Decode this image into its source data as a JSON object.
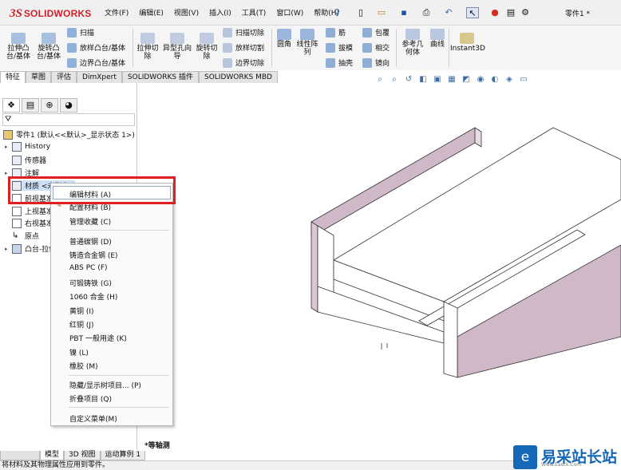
{
  "app": {
    "logo_ds": "3S",
    "logo_text": "SOLIDWORKS",
    "doc_title": "零件1 *"
  },
  "menu": [
    "文件(F)",
    "编辑(E)",
    "视图(V)",
    "插入(I)",
    "工具(T)",
    "窗口(W)",
    "帮助(H)"
  ],
  "commands": {
    "extrude_boss": "拉伸凸台/基体",
    "revolve_boss": "旋转凸台/基体",
    "sweep": "扫描",
    "loft_boss": "放样凸台/基体",
    "boundary_boss": "边界凸台/基体",
    "extrude_cut": "拉伸切除",
    "hole_wizard": "异型孔向导",
    "revolve_cut": "旋转切除",
    "sweep_cut": "扫描切除",
    "loft_cut": "放样切割",
    "boundary_cut": "边界切除",
    "fillet": "圆角",
    "linear_pattern": "线性阵列",
    "rib": "筋",
    "wrap": "包覆",
    "draft": "拔模",
    "intersect": "相交",
    "shell": "抽壳",
    "mirror": "镜向",
    "ref_geometry": "参考几何体",
    "curves": "曲线",
    "instant3d": "Instant3D"
  },
  "tabs": [
    "特征",
    "草图",
    "评估",
    "DimXpert",
    "SOLIDWORKS 插件",
    "SOLIDWORKS MBD"
  ],
  "tree": {
    "root": "零件1  (默认<<默认>_显示状态 1>)",
    "history": "History",
    "sensors": "传感器",
    "annotations": "注解",
    "material": "材质 <未指定>",
    "front_plane": "前视基准面",
    "top_plane": "上视基准面",
    "right_plane": "右视基准面",
    "origin": "原点",
    "boss_extrude": "凸台-拉伸1"
  },
  "context_menu": {
    "top": [
      "编辑材料 (A)",
      "配置材料 (B)",
      "管理收藏 (C)"
    ],
    "materials": [
      "普通碳钢 (D)",
      "铸造合金钢 (E)",
      "ABS PC (F)",
      "可锻铸铁 (G)",
      "1060 合金 (H)",
      "黄铜 (I)",
      "红铜 (J)",
      "PBT 一般用途 (K)",
      "镍 (L)",
      "橡胶 (M)"
    ],
    "tree_items": [
      "隐藏/显示树项目... (P)",
      "折叠项目 (Q)"
    ],
    "customize": "自定义菜单(M)"
  },
  "viewport": {
    "orientation_label": "*等轴测",
    "part_color": "#cfb8c8"
  },
  "bottom_tabs": [
    "模型",
    "3D 视图",
    "运动算例 1"
  ],
  "status": "将材料及其物理属性应用到零件。",
  "watermark": {
    "text": "易采站长站",
    "url": "Www.Easck.Com"
  },
  "colors": {
    "accent_red": "#d0202a",
    "highlight_box": "#e02020",
    "watermark_blue": "#1667b8"
  }
}
